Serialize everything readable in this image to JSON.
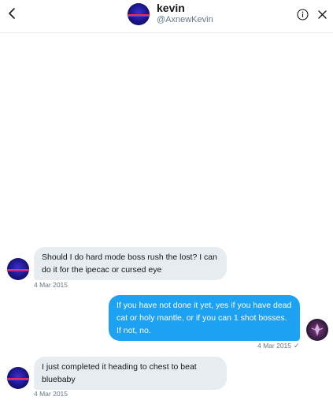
{
  "header": {
    "name": "kevin",
    "handle": "@AxnewKevin",
    "back_icon": "back-arrow-icon",
    "info_icon": "info-icon",
    "close_icon": "close-icon"
  },
  "messages": [
    {
      "direction": "in",
      "text": "Should I do hard mode boss rush the lost? I can do it for the ipecac or cursed eye",
      "timestamp": "4 Mar 2015"
    },
    {
      "direction": "out",
      "text": "If you have not done it yet, yes if you have dead cat or holy mantle, or if you can 1 shot bosses. If not, no.",
      "timestamp": "4 Mar 2015",
      "status_icon": "✓"
    },
    {
      "direction": "in",
      "text": "I just completed it heading to chest to beat bluebaby",
      "timestamp": "4 Mar 2015"
    }
  ],
  "colors": {
    "accent": "#1da1f2",
    "incoming_bubble": "#e6ecf0",
    "muted_text": "#657786"
  }
}
